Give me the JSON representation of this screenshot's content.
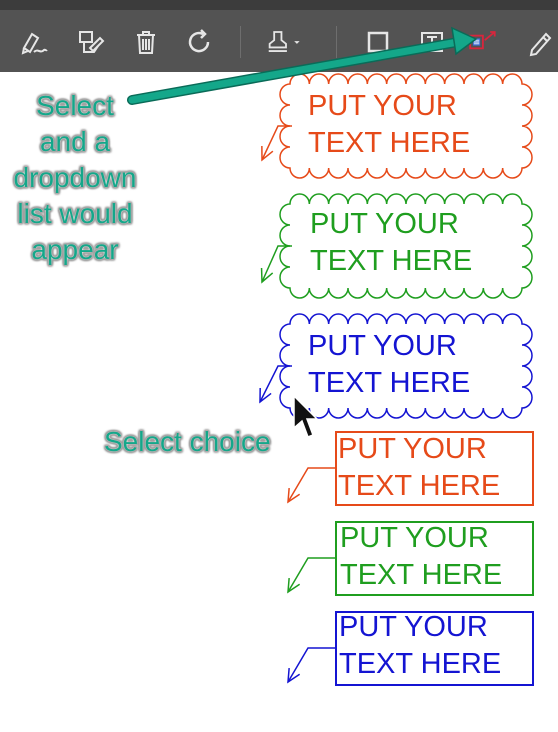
{
  "toolbar": {
    "buttons": [
      {
        "name": "sign-pen-icon"
      },
      {
        "name": "edit-tag-icon"
      },
      {
        "name": "trash-icon"
      },
      {
        "name": "redo-icon"
      },
      {
        "name": "stamp-icon"
      },
      {
        "name": "rectangle-icon"
      },
      {
        "name": "text-box-icon"
      },
      {
        "name": "callout-icon",
        "selected": true
      },
      {
        "name": "pencil-icon"
      }
    ]
  },
  "annotations": {
    "select_note": [
      "Select",
      "and a",
      "dropdown",
      "list would",
      "appear"
    ],
    "choice_note": "Select choice",
    "accent_color": "#14a78a"
  },
  "callouts": [
    {
      "style": "cloud",
      "color": "#e64a19",
      "line1": "PUT YOUR",
      "line2": "TEXT HERE"
    },
    {
      "style": "cloud",
      "color": "#1f9e1f",
      "line1": "PUT YOUR",
      "line2": "TEXT HERE"
    },
    {
      "style": "cloud",
      "color": "#1414d2",
      "line1": "PUT YOUR",
      "line2": "TEXT HERE"
    },
    {
      "style": "box",
      "color": "#e64a19",
      "line1": "PUT YOUR",
      "line2": "TEXT HERE"
    },
    {
      "style": "box",
      "color": "#1f9e1f",
      "line1": "PUT YOUR",
      "line2": "TEXT HERE"
    },
    {
      "style": "box",
      "color": "#1414d2",
      "line1": "PUT YOUR",
      "line2": "TEXT HERE"
    }
  ]
}
